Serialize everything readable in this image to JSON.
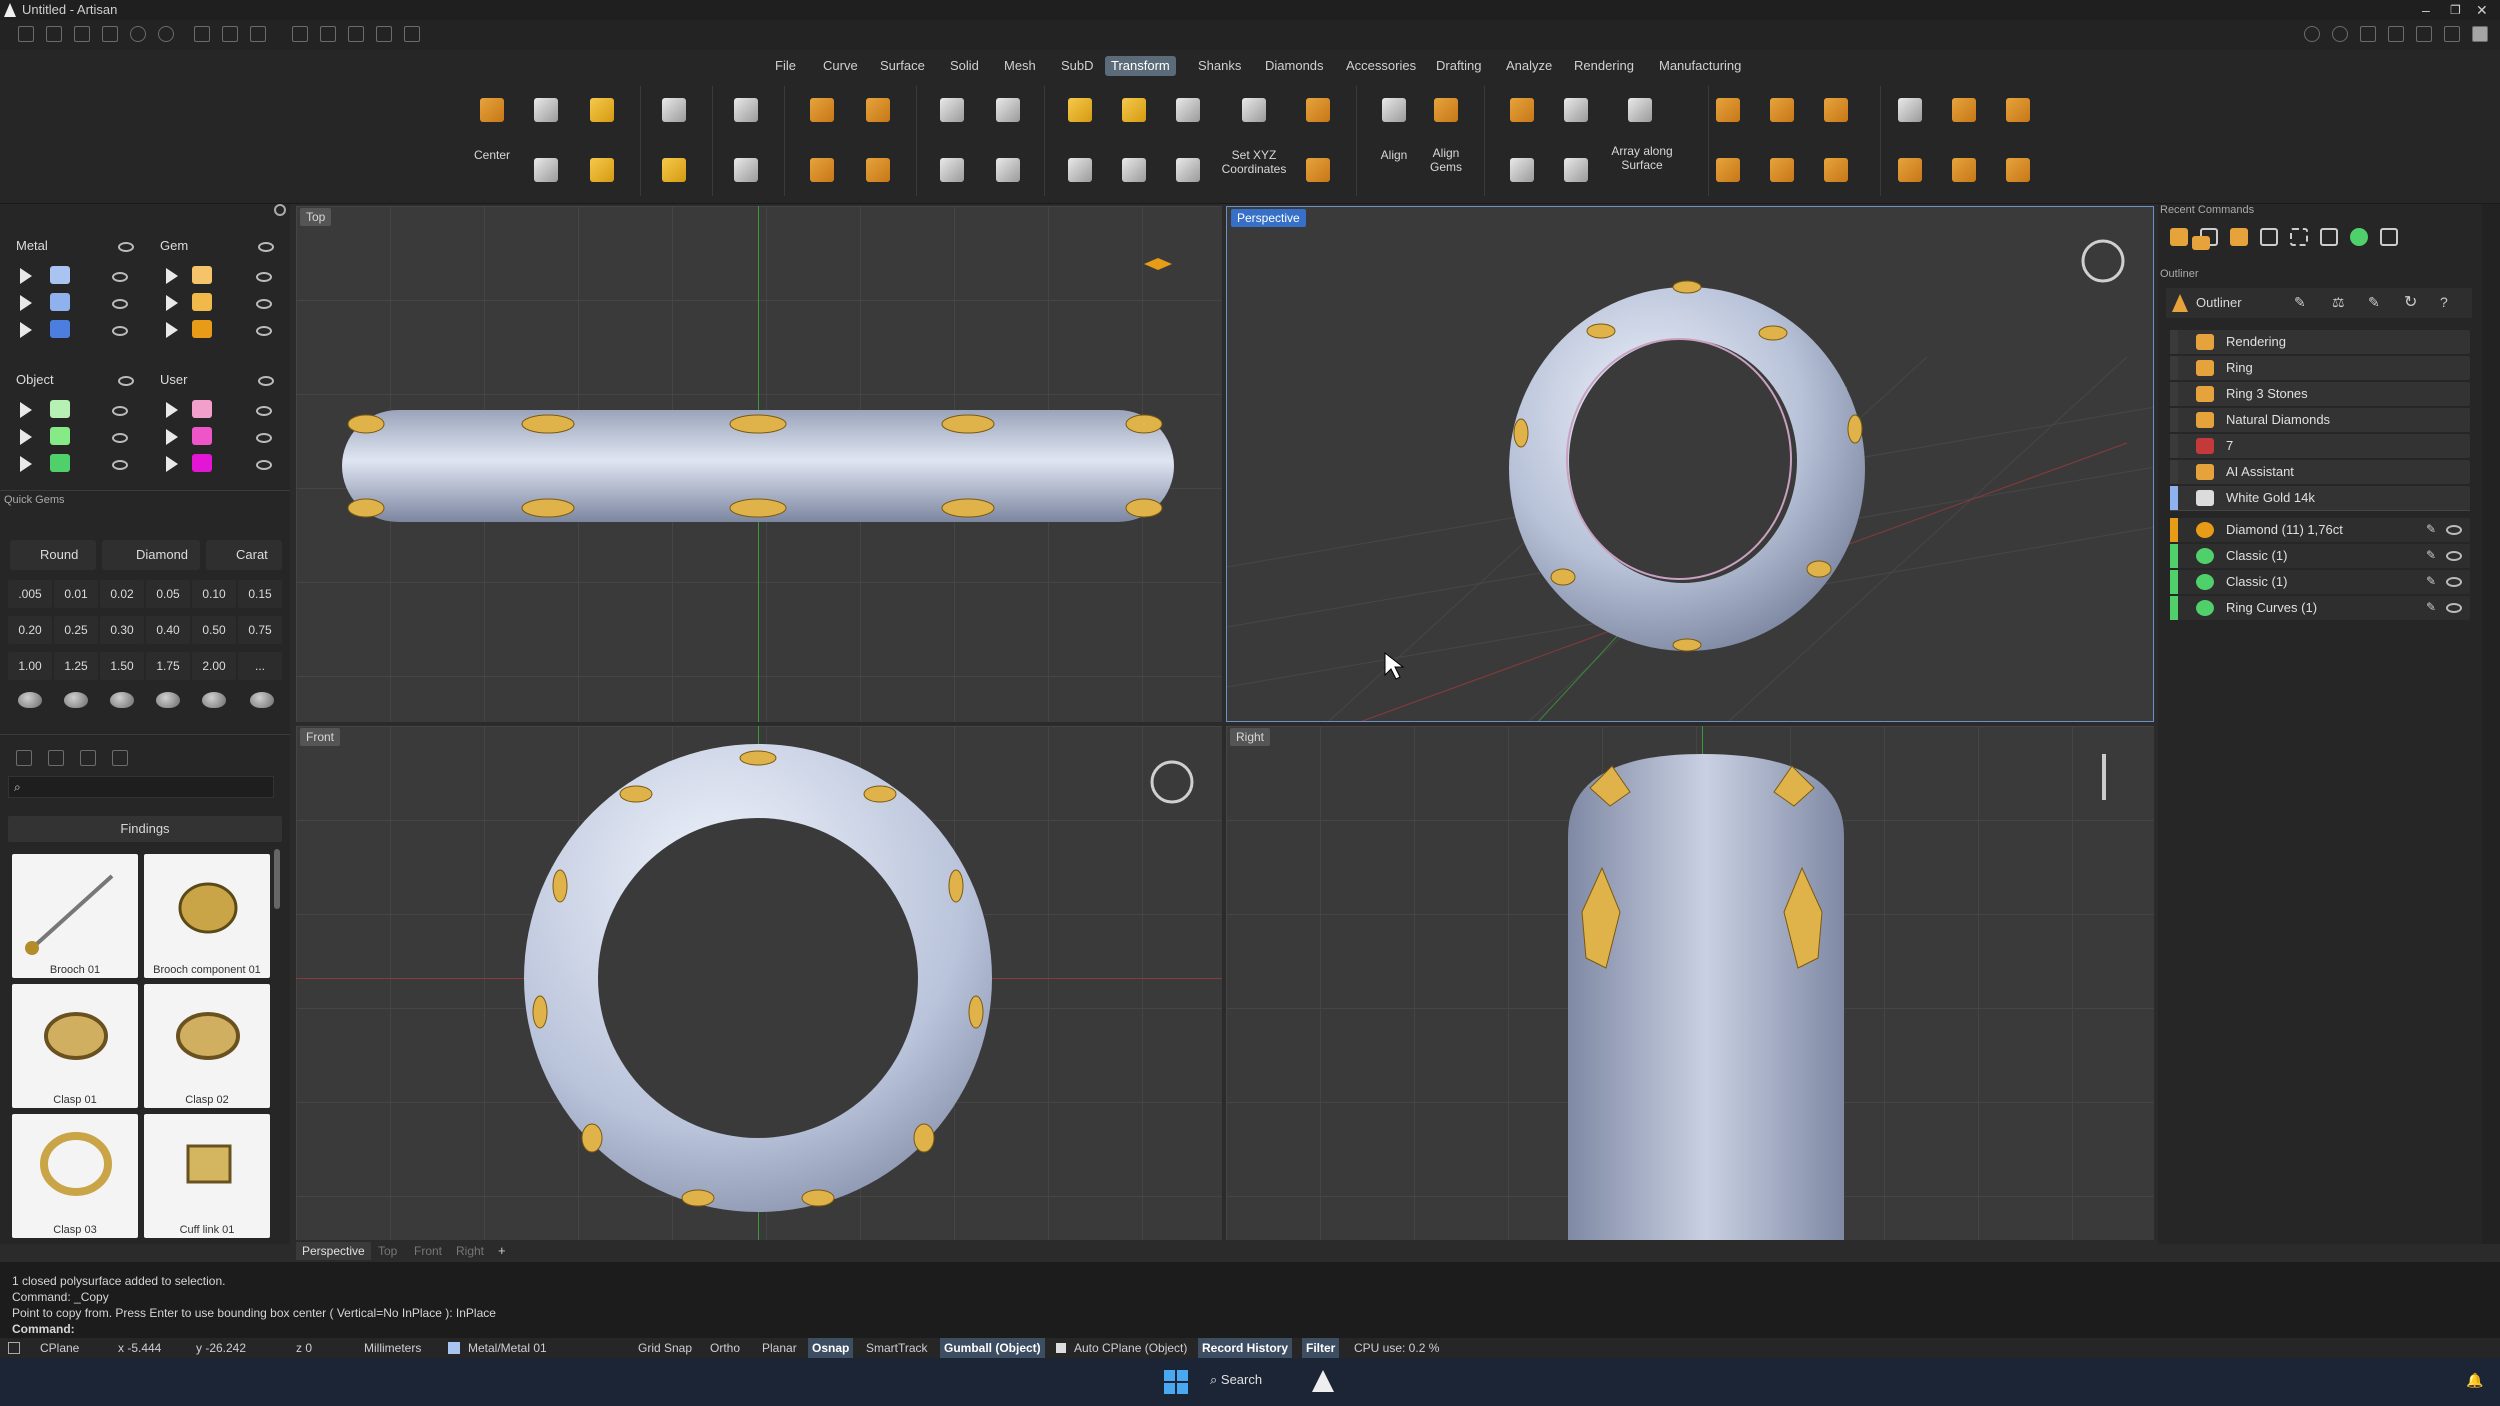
{
  "window": {
    "title": "Untitled - Artisan"
  },
  "ribbon_tabs": [
    "File",
    "Curve",
    "Surface",
    "Solid",
    "Mesh",
    "SubD",
    "Transform",
    "Shanks",
    "Diamonds",
    "Accessories",
    "Drafting",
    "Analyze",
    "Rendering",
    "Manufacturing"
  ],
  "active_tab": "Transform",
  "ribbon_labels": {
    "center": "Center",
    "set_xyz": "Set XYZ Coordinates",
    "align": "Align",
    "align_gems": "Align Gems",
    "array_along_surface": "Array along Surface"
  },
  "layers": {
    "metal": {
      "title": "Metal",
      "colors": [
        "#a9c4f0",
        "#8fb2ee",
        "#4c7ee0"
      ]
    },
    "gem": {
      "title": "Gem",
      "colors": [
        "#f4c36a",
        "#f1b84a",
        "#e89b16"
      ]
    },
    "object": {
      "title": "Object",
      "colors": [
        "#b6f0b4",
        "#86ea86",
        "#4fd06b"
      ]
    },
    "user": {
      "title": "User",
      "colors": [
        "#f39fcc",
        "#ee55c8",
        "#e316d6"
      ]
    }
  },
  "quick_gems": {
    "title": "Quick Gems",
    "buttons": [
      "Round",
      "Diamond",
      "Carat"
    ],
    "sizes": [
      ".005",
      "0.01",
      "0.02",
      "0.05",
      "0.10",
      "0.15",
      "0.20",
      "0.25",
      "0.30",
      "0.40",
      "0.50",
      "0.75",
      "1.00",
      "1.25",
      "1.50",
      "1.75",
      "2.00",
      "..."
    ]
  },
  "library": {
    "search_placeholder": "",
    "category": "Findings",
    "items": [
      "Brooch 01",
      "Brooch component 01",
      "Clasp 01",
      "Clasp 02",
      "Clasp 03",
      "Cuff link 01"
    ]
  },
  "viewports": {
    "top": {
      "label": "Top"
    },
    "perspective": {
      "label": "Perspective"
    },
    "front": {
      "label": "Front"
    },
    "right": {
      "label": "Right"
    }
  },
  "viewport_tabs": [
    "Perspective",
    "Top",
    "Front",
    "Right",
    "+"
  ],
  "right_panel": {
    "recent_commands_title": "Recent Commands",
    "outliner_header": "Outliner",
    "outliner_title": "Outliner",
    "outliner_items": [
      {
        "label": "Rendering",
        "color": "#3a3a3a",
        "icon": "#e6a33b"
      },
      {
        "label": "Ring",
        "color": "#3a3a3a",
        "icon": "#e6a33b"
      },
      {
        "label": "Ring 3 Stones",
        "color": "#3a3a3a",
        "icon": "#e6a33b"
      },
      {
        "label": "Natural Diamonds",
        "color": "#3a3a3a",
        "icon": "#e6a33b"
      },
      {
        "label": "7",
        "color": "#3a3a3a",
        "icon": "#c43a3a"
      },
      {
        "label": "AI Assistant",
        "color": "#3a3a3a",
        "icon": "#e6a33b"
      },
      {
        "label": "White Gold 14k",
        "color": "#8fb2ee",
        "icon": "#dcdcdc"
      }
    ],
    "scene_items": [
      {
        "label": "Diamond (11) 1,76ct",
        "color": "#e89b16"
      },
      {
        "label": "Classic (1)",
        "color": "#4fd06b"
      },
      {
        "label": "Classic (1)",
        "color": "#4fd06b"
      },
      {
        "label": "Ring Curves (1)",
        "color": "#4fd06b"
      }
    ]
  },
  "command_history": [
    "1 closed polysurface added to selection.",
    "Command: _Copy",
    "Point to copy from. Press Enter to use bounding box center ( Vertical=No  InPlace ): InPlace"
  ],
  "command_prompt": "Command:",
  "status": {
    "cplane": "CPlane",
    "x": "x -5.444",
    "y": "y -26.242",
    "z": "z 0",
    "units": "Millimeters",
    "layer": "Metal/Metal 01",
    "grid_snap": "Grid Snap",
    "ortho": "Ortho",
    "planar": "Planar",
    "osnap": "Osnap",
    "smarttrack": "SmartTrack",
    "gumball": "Gumball (Object)",
    "auto_cplane": "Auto CPlane (Object)",
    "record_history": "Record History",
    "filter": "Filter",
    "cpu": "CPU use: 0.2 %"
  },
  "taskbar": {
    "search": "Search"
  }
}
